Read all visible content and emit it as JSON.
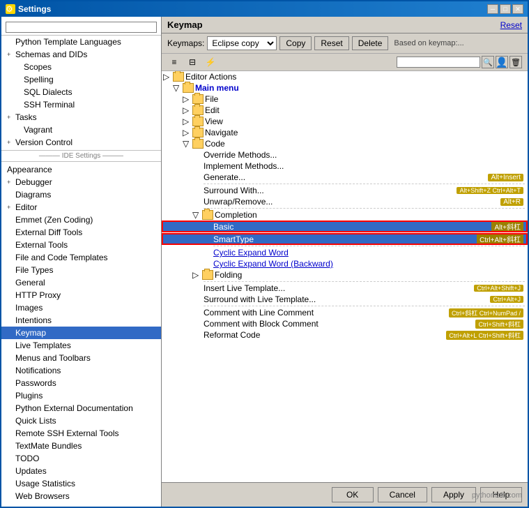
{
  "window": {
    "title": "Settings",
    "close_btn": "✕",
    "minimize_btn": "─",
    "maximize_btn": "□"
  },
  "panel": {
    "title": "Keymap",
    "reset_label": "Reset"
  },
  "keymap_toolbar": {
    "label": "Keymaps:",
    "selected_keymap": "Eclipse copy",
    "copy_btn": "Copy",
    "reset_btn": "Reset",
    "delete_btn": "Delete",
    "based_on": "Based on keymap:..."
  },
  "icon_toolbar": {
    "icon1": "≡",
    "icon2": "⊞",
    "icon3": "≈"
  },
  "sidebar": {
    "search_placeholder": "",
    "items": [
      {
        "label": "Python Template Languages",
        "indent": 1,
        "expanded": false
      },
      {
        "label": "Schemas and DIDs",
        "indent": 0,
        "expanded": false,
        "has_expand": true
      },
      {
        "label": "Scopes",
        "indent": 1
      },
      {
        "label": "Spelling",
        "indent": 1
      },
      {
        "label": "SQL Dialects",
        "indent": 1
      },
      {
        "label": "SSH Terminal",
        "indent": 1
      },
      {
        "label": "Tasks",
        "indent": 0,
        "has_expand": true
      },
      {
        "label": "Vagrant",
        "indent": 1
      },
      {
        "label": "Version Control",
        "indent": 0,
        "has_expand": true
      },
      {
        "label": "IDE Settings",
        "type": "separator"
      },
      {
        "label": "Appearance",
        "indent": 0
      },
      {
        "label": "Debugger",
        "indent": 0,
        "has_expand": true
      },
      {
        "label": "Diagrams",
        "indent": 0
      },
      {
        "label": "Editor",
        "indent": 0,
        "has_expand": true
      },
      {
        "label": "Emmet (Zen Coding)",
        "indent": 1
      },
      {
        "label": "External Diff Tools",
        "indent": 1
      },
      {
        "label": "External Tools",
        "indent": 1
      },
      {
        "label": "File and Code Templates",
        "indent": 1
      },
      {
        "label": "File Types",
        "indent": 1
      },
      {
        "label": "General",
        "indent": 1
      },
      {
        "label": "HTTP Proxy",
        "indent": 1
      },
      {
        "label": "Images",
        "indent": 1
      },
      {
        "label": "Intentions",
        "indent": 1
      },
      {
        "label": "Keymap",
        "indent": 1,
        "selected": true
      },
      {
        "label": "Live Templates",
        "indent": 1
      },
      {
        "label": "Menus and Toolbars",
        "indent": 1
      },
      {
        "label": "Notifications",
        "indent": 1
      },
      {
        "label": "Passwords",
        "indent": 1
      },
      {
        "label": "Plugins",
        "indent": 1
      },
      {
        "label": "Python External Documentation",
        "indent": 1
      },
      {
        "label": "Quick Lists",
        "indent": 1
      },
      {
        "label": "Remote SSH External Tools",
        "indent": 1
      },
      {
        "label": "TextMate Bundles",
        "indent": 1
      },
      {
        "label": "TODO",
        "indent": 1
      },
      {
        "label": "Updates",
        "indent": 1
      },
      {
        "label": "Usage Statistics",
        "indent": 1
      },
      {
        "label": "Web Browsers",
        "indent": 1
      }
    ]
  },
  "tree": {
    "items": [
      {
        "type": "folder",
        "label": "Editor Actions",
        "indent": 0,
        "expanded": true
      },
      {
        "type": "folder",
        "label": "Main menu",
        "indent": 1,
        "expanded": true,
        "color": "blue"
      },
      {
        "type": "folder",
        "label": "File",
        "indent": 2,
        "expanded": false
      },
      {
        "type": "folder",
        "label": "Edit",
        "indent": 2,
        "expanded": false
      },
      {
        "type": "folder",
        "label": "View",
        "indent": 2,
        "expanded": false
      },
      {
        "type": "folder",
        "label": "Navigate",
        "indent": 2,
        "expanded": false
      },
      {
        "type": "folder",
        "label": "Code",
        "indent": 2,
        "expanded": true
      },
      {
        "type": "item",
        "label": "Override Methods...",
        "indent": 4,
        "shortcut": ""
      },
      {
        "type": "item",
        "label": "Implement Methods...",
        "indent": 4,
        "shortcut": ""
      },
      {
        "type": "item",
        "label": "Generate...",
        "indent": 4,
        "shortcut": "Alt+Insert"
      },
      {
        "type": "separator",
        "indent": 4
      },
      {
        "type": "item",
        "label": "Surround With...",
        "indent": 4,
        "shortcut": "Alt+Shift+Z Ctrl+Alt+T"
      },
      {
        "type": "item",
        "label": "Unwrap/Remove...",
        "indent": 4,
        "shortcut": "Alt+R"
      },
      {
        "type": "separator",
        "indent": 4
      },
      {
        "type": "folder",
        "label": "Completion",
        "indent": 3,
        "expanded": true
      },
      {
        "type": "item",
        "label": "Basic",
        "indent": 5,
        "shortcut": "Alt+斜杠",
        "selected": true
      },
      {
        "type": "item",
        "label": "SmartType",
        "indent": 5,
        "shortcut": "Ctrl+Alt+斜杠",
        "selected": true,
        "outlined": true
      },
      {
        "type": "separator",
        "indent": 5
      },
      {
        "type": "item",
        "label": "Cyclic Expand Word",
        "indent": 5,
        "link": true
      },
      {
        "type": "item",
        "label": "Cyclic Expand Word (Backward)",
        "indent": 5,
        "link": true
      },
      {
        "type": "folder",
        "label": "Folding",
        "indent": 3,
        "expanded": false
      },
      {
        "type": "separator",
        "indent": 4
      },
      {
        "type": "item",
        "label": "Insert Live Template...",
        "indent": 4,
        "shortcut": "Ctrl+Alt+Shift+J"
      },
      {
        "type": "item",
        "label": "Surround with Live Template...",
        "indent": 4,
        "shortcut": "Ctrl+Alt+J"
      },
      {
        "type": "separator",
        "indent": 4
      },
      {
        "type": "item",
        "label": "Comment with Line Comment",
        "indent": 4,
        "shortcut": "Ctrl+斜杠  Ctrl+NumPad /"
      },
      {
        "type": "item",
        "label": "Comment with Block Comment",
        "indent": 4,
        "shortcut": "Ctrl+Shift+斜杠"
      },
      {
        "type": "item",
        "label": "Reformat Code",
        "indent": 4,
        "shortcut": "Ctrl+Alt+L  Ctrl+Shift+斜杠"
      }
    ]
  },
  "bottom_bar": {
    "ok_label": "OK",
    "cancel_label": "Cancel",
    "apply_label": "Apply",
    "help_label": "Help"
  },
  "watermark": "pythontab.com"
}
